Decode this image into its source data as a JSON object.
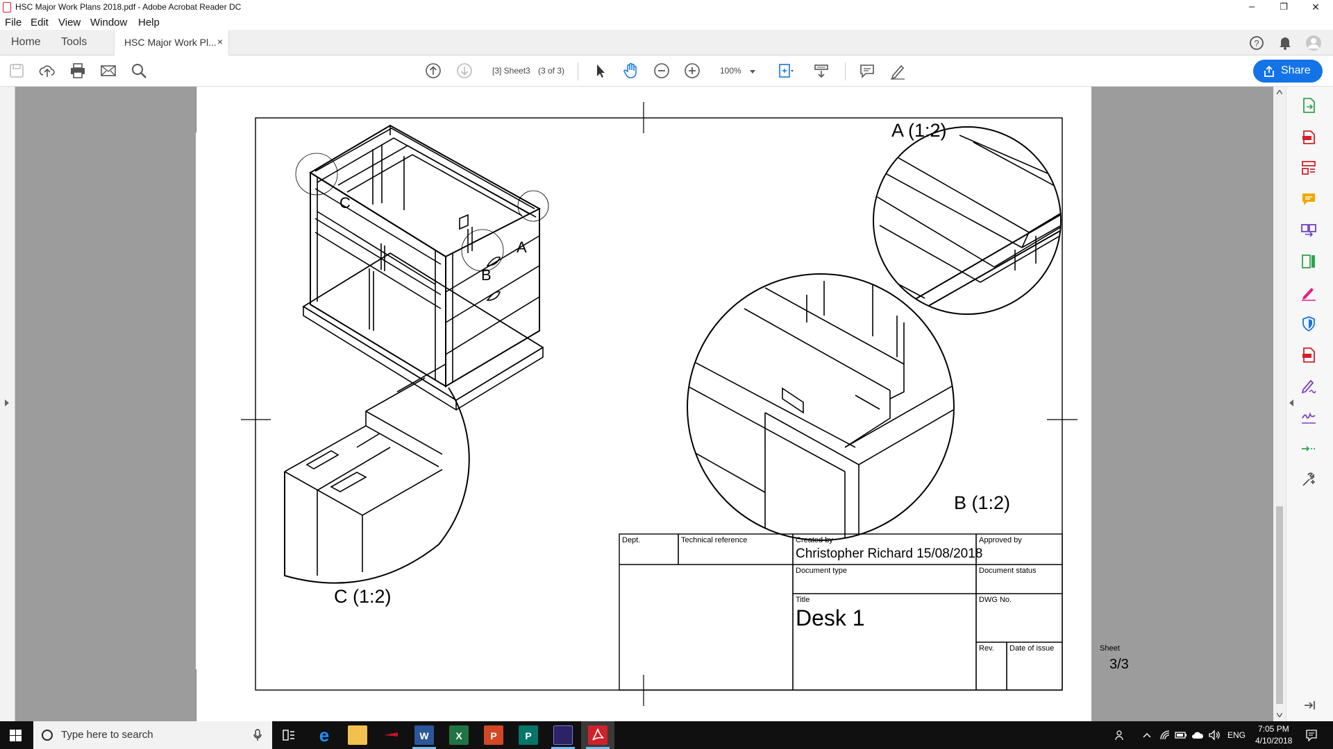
{
  "window": {
    "title": "HSC Major Work Plans 2018.pdf - Adobe Acrobat Reader DC",
    "minimize": "–",
    "restore": "❐",
    "close": "✕"
  },
  "menu": [
    "File",
    "Edit",
    "View",
    "Window",
    "Help"
  ],
  "nav": {
    "home": "Home",
    "tools": "Tools",
    "doc_tab": "HSC Major Work Pl...",
    "doc_tab_close": "×"
  },
  "toolbar": {
    "page_label": "[3] Sheet3",
    "page_count": "(3 of 3)",
    "zoom": "100%",
    "share": "Share"
  },
  "drawing": {
    "views": {
      "a": "A (1:2)",
      "b": "B (1:2)",
      "c": "C (1:2)"
    },
    "callouts": {
      "a": "A",
      "b": "B",
      "c": "C"
    },
    "title_block": {
      "dept_label": "Dept.",
      "tech_ref_label": "Technical reference",
      "created_by_label": "Created by",
      "created_by": "Christopher Richard 15/08/2018",
      "approved_by_label": "Approved by",
      "doc_type_label": "Document type",
      "doc_status_label": "Document status",
      "title_label": "Title",
      "title": "Desk 1",
      "dwg_label": "DWG No.",
      "rev_label": "Rev.",
      "date_label": "Date of issue",
      "sheet_label": "Sheet",
      "sheet": "3/3"
    }
  },
  "taskbar": {
    "search_placeholder": "Type here to search",
    "lang": "ENG",
    "time": "7:05 PM",
    "date": "4/10/2018"
  },
  "colors": {
    "accent": "#1473e6",
    "acrobat_red": "#d0222a",
    "rightpanel_green": "#2da44e"
  }
}
